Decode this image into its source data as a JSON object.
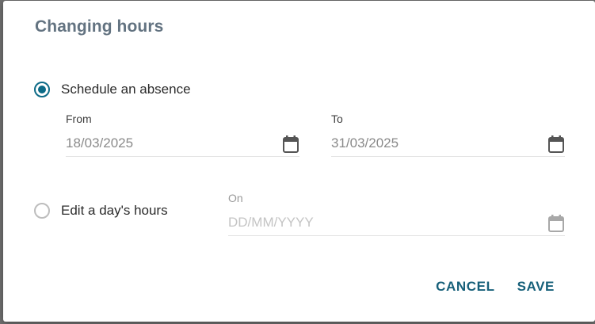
{
  "dialog": {
    "title": "Changing hours"
  },
  "options": {
    "absence": {
      "label": "Schedule an absence",
      "checked": true,
      "from": {
        "label": "From",
        "value": "18/03/2025"
      },
      "to": {
        "label": "To",
        "value": "31/03/2025"
      }
    },
    "edit_day": {
      "label": "Edit a day's hours",
      "checked": false,
      "on": {
        "label": "On",
        "value": "",
        "placeholder": "DD/MM/YYYY"
      }
    }
  },
  "actions": {
    "cancel_label": "CANCEL",
    "save_label": "SAVE"
  },
  "icons": {
    "date_picker": "calendar-icon"
  },
  "colors": {
    "accent": "#0d6b87",
    "button_text": "#17607a",
    "title": "#637381"
  }
}
